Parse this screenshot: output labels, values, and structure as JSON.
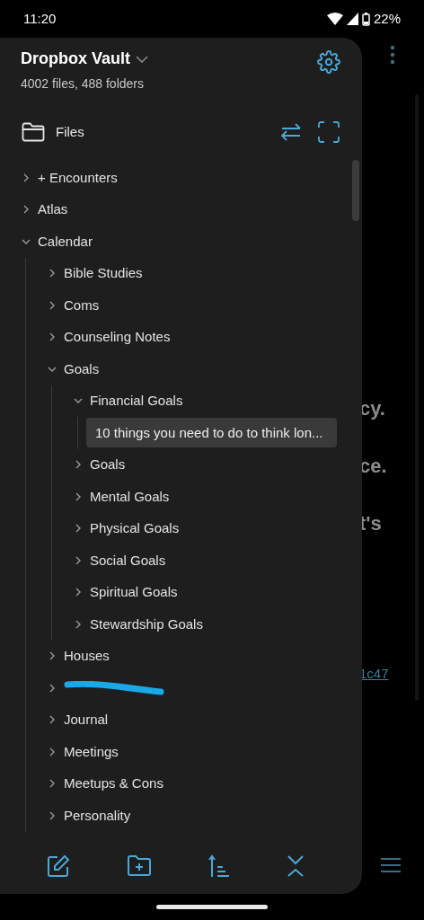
{
  "status_bar": {
    "time": "11:20",
    "battery": "22%"
  },
  "background_page": {
    "fragments": [
      "cy.",
      "ce.",
      "t's"
    ],
    "link": "1c47"
  },
  "drawer": {
    "vault_name": "Dropbox Vault",
    "stats": "4002 files, 488 folders",
    "section": "Files",
    "tree": [
      {
        "kind": "folder",
        "label": "+ Encounters",
        "expanded": false
      },
      {
        "kind": "folder",
        "label": "Atlas",
        "expanded": false
      },
      {
        "kind": "folder",
        "label": "Calendar",
        "expanded": true,
        "children": [
          {
            "kind": "folder",
            "label": "Bible Studies",
            "expanded": false
          },
          {
            "kind": "folder",
            "label": "Coms",
            "expanded": false
          },
          {
            "kind": "folder",
            "label": "Counseling Notes",
            "expanded": false
          },
          {
            "kind": "folder",
            "label": "Goals",
            "expanded": true,
            "children": [
              {
                "kind": "folder",
                "label": "Financial Goals",
                "expanded": true,
                "children": [
                  {
                    "kind": "file",
                    "label": "10 things you need to do to think lon...",
                    "selected": true
                  }
                ]
              },
              {
                "kind": "folder",
                "label": "Goals",
                "expanded": false
              },
              {
                "kind": "folder",
                "label": "Mental Goals",
                "expanded": false
              },
              {
                "kind": "folder",
                "label": "Physical Goals",
                "expanded": false
              },
              {
                "kind": "folder",
                "label": "Social Goals",
                "expanded": false
              },
              {
                "kind": "folder",
                "label": "Spiritual Goals",
                "expanded": false
              },
              {
                "kind": "folder",
                "label": "Stewardship Goals",
                "expanded": false
              }
            ]
          },
          {
            "kind": "folder",
            "label": "Houses",
            "expanded": false
          },
          {
            "kind": "redacted",
            "expanded": false
          },
          {
            "kind": "folder",
            "label": "Journal",
            "expanded": false
          },
          {
            "kind": "folder",
            "label": "Meetings",
            "expanded": false
          },
          {
            "kind": "folder",
            "label": "Meetups & Cons",
            "expanded": false
          },
          {
            "kind": "folder",
            "label": "Personality",
            "expanded": false
          }
        ]
      }
    ]
  }
}
